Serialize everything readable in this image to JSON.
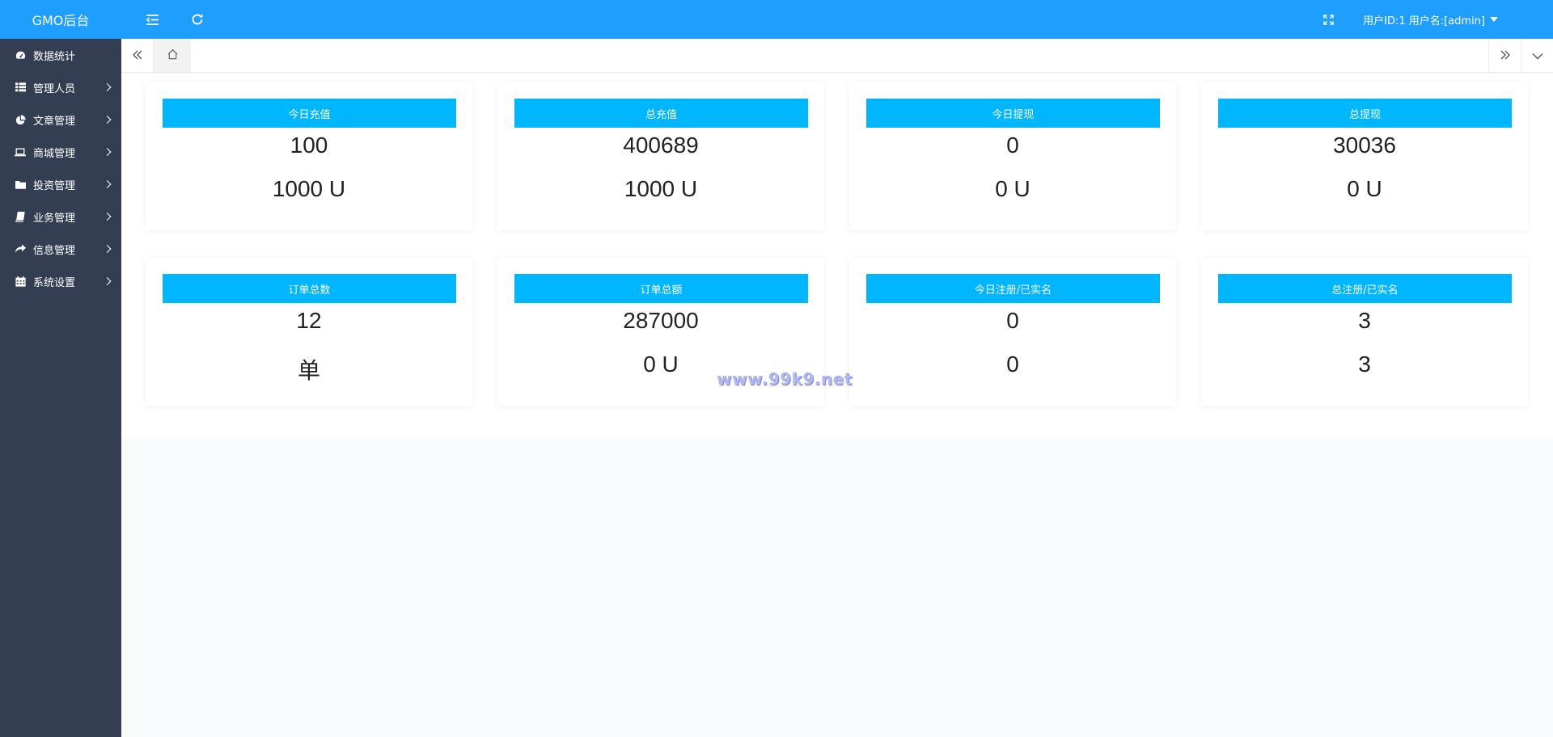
{
  "app": {
    "logo": "GMO后台"
  },
  "sidebar": {
    "items": [
      {
        "label": "数据统计",
        "icon": "dashboard-icon",
        "has_arrow": false
      },
      {
        "label": "管理人员",
        "icon": "grid-icon",
        "has_arrow": true
      },
      {
        "label": "文章管理",
        "icon": "pie-chart-icon",
        "has_arrow": true
      },
      {
        "label": "商城管理",
        "icon": "laptop-icon",
        "has_arrow": true
      },
      {
        "label": "投资管理",
        "icon": "folder-icon",
        "has_arrow": true
      },
      {
        "label": "业务管理",
        "icon": "book-icon",
        "has_arrow": true
      },
      {
        "label": "信息管理",
        "icon": "share-icon",
        "has_arrow": true
      },
      {
        "label": "系统设置",
        "icon": "calendar-icon",
        "has_arrow": true
      }
    ]
  },
  "header": {
    "user_info": "用户ID:1 用户名:[admin]",
    "icons": [
      "menu-toggle-icon",
      "refresh-icon",
      "fullscreen-icon",
      "caret-down-icon"
    ]
  },
  "tabs": {
    "icons": [
      "double-chevron-left-icon",
      "home-icon",
      "double-chevron-right-icon",
      "chevron-down-icon"
    ]
  },
  "stats": [
    {
      "title": "今日充值",
      "value1": "100",
      "value2": "1000 U"
    },
    {
      "title": "总充值",
      "value1": "400689",
      "value2": "1000 U"
    },
    {
      "title": "今日提现",
      "value1": "0",
      "value2": "0 U"
    },
    {
      "title": "总提现",
      "value1": "30036",
      "value2": "0 U"
    },
    {
      "title": "订单总数",
      "value1": "12",
      "value2": "单"
    },
    {
      "title": "订单总额",
      "value1": "287000",
      "value2": "0 U"
    },
    {
      "title": "今日注册/已实名",
      "value1": "0",
      "value2": "0"
    },
    {
      "title": "总注册/已实名",
      "value1": "3",
      "value2": "3"
    }
  ],
  "watermark": "www.99k9.net",
  "colors": {
    "header": "#1e9fff",
    "sidebar": "#343e52",
    "card_title": "#00b7ff"
  }
}
